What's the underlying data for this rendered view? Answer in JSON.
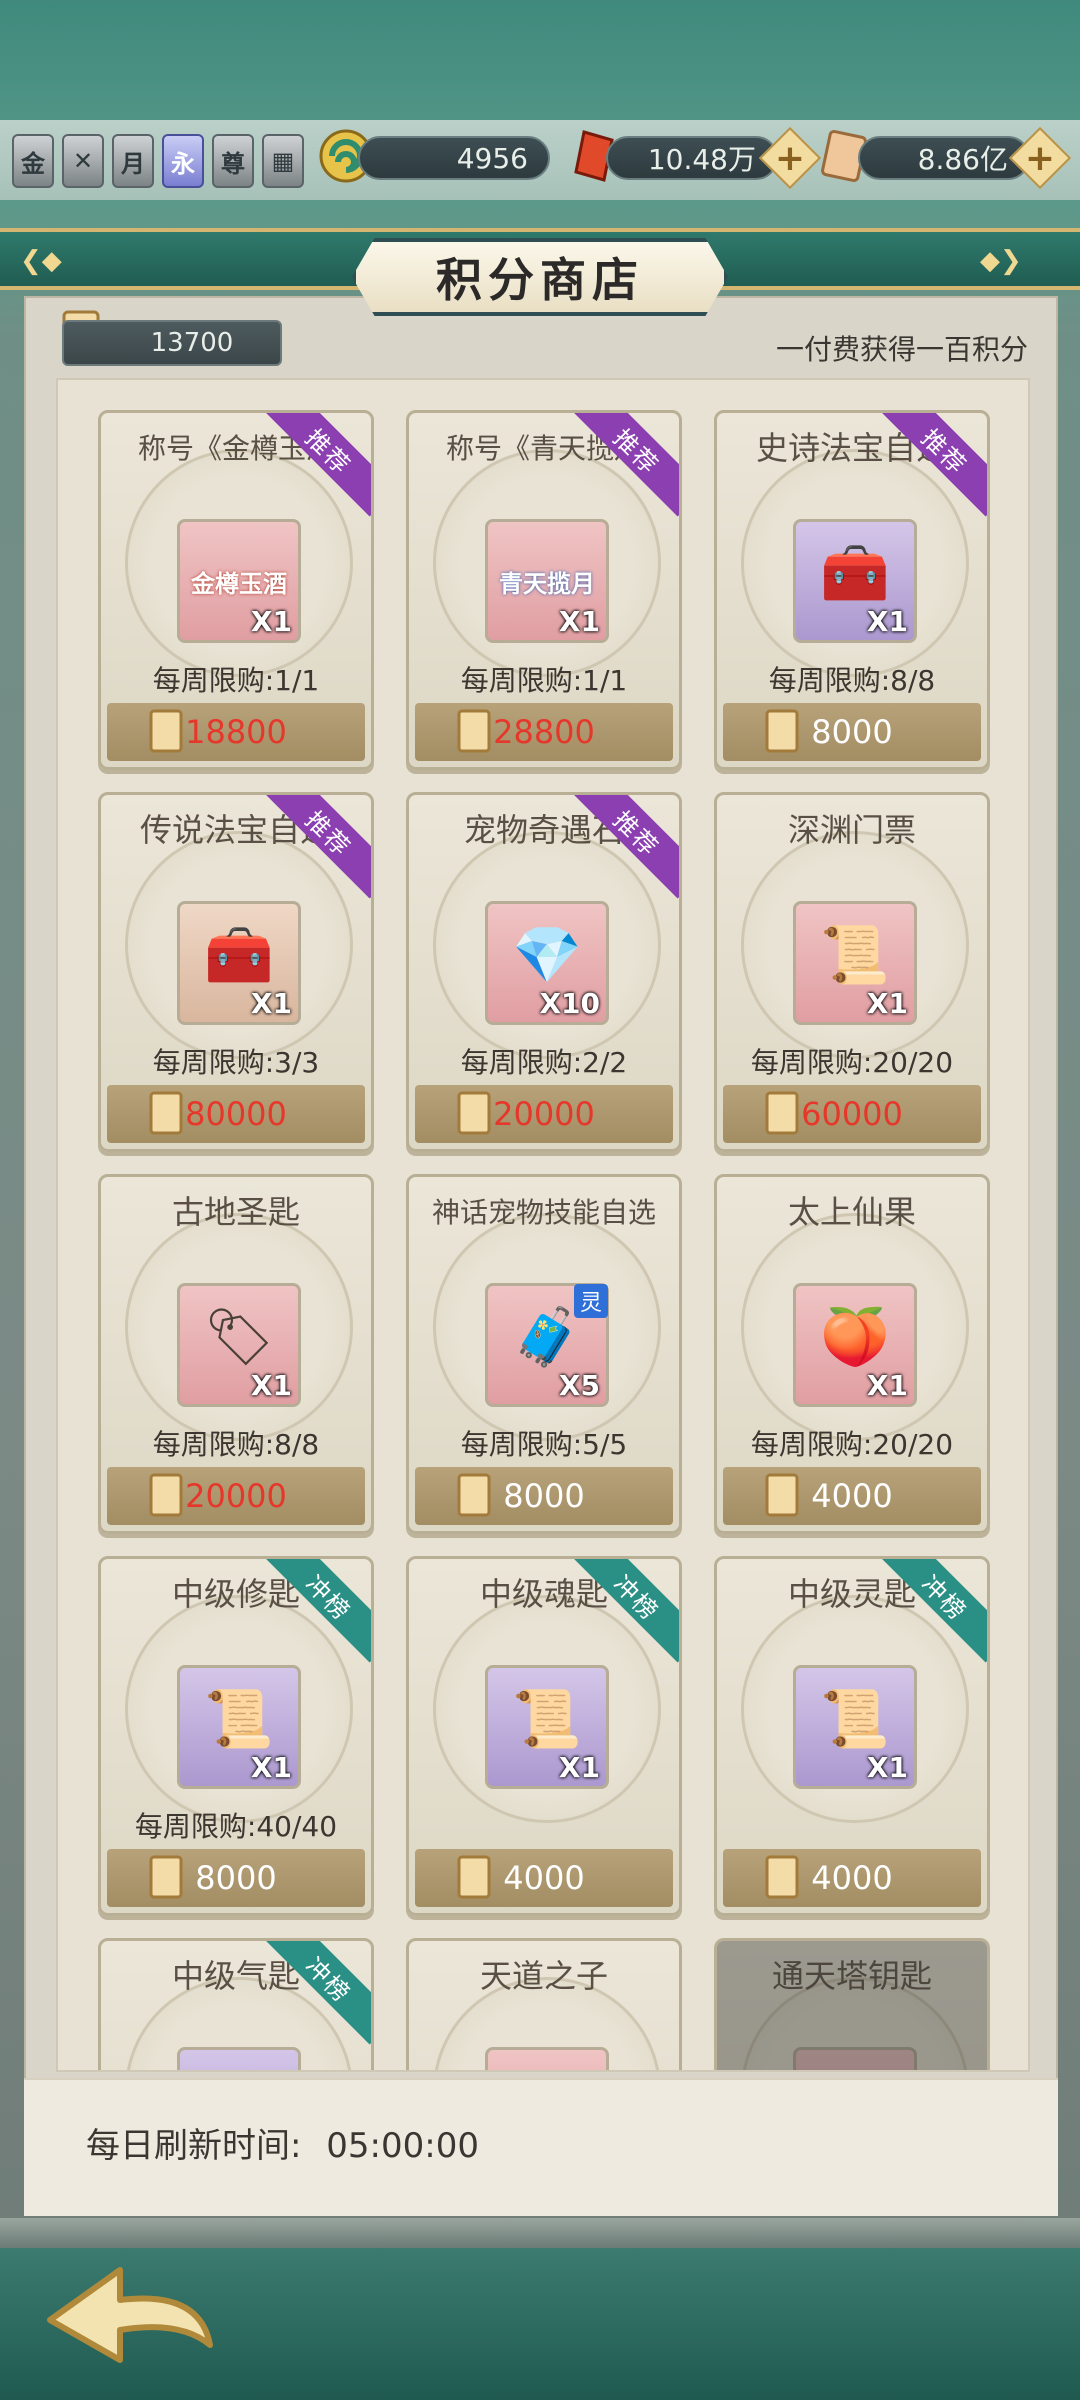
{
  "badges": [
    "金",
    "",
    "月",
    "永",
    "尊",
    ""
  ],
  "currencies": {
    "jade": "4956",
    "crystal": "10.48万",
    "scroll": "8.86亿"
  },
  "title": "积分商店",
  "points": "13700",
  "tip": "一付费获得一百积分",
  "items": [
    {
      "name": "称号《金樽玉酒",
      "qty": "X1",
      "limit": "每周限购:1/1",
      "price": "18800",
      "tag": "推荐",
      "thumb_text": "金樽玉酒"
    },
    {
      "name": "称号《青天揽月",
      "qty": "X1",
      "limit": "每周限购:1/1",
      "price": "28800",
      "tag": "推荐",
      "thumb_text": "青天揽月"
    },
    {
      "name": "史诗法宝自选",
      "qty": "X1",
      "limit": "每周限购:8/8",
      "price": "8000",
      "tag": "推荐"
    },
    {
      "name": "传说法宝自选",
      "qty": "X1",
      "limit": "每周限购:3/3",
      "price": "80000",
      "tag": "推荐"
    },
    {
      "name": "宠物奇遇石",
      "qty": "X10",
      "limit": "每周限购:2/2",
      "price": "20000",
      "tag": "推荐"
    },
    {
      "name": "深渊门票",
      "qty": "X1",
      "limit": "每周限购:20/20",
      "price": "60000"
    },
    {
      "name": "古地圣匙",
      "qty": "X1",
      "limit": "每周限购:8/8",
      "price": "20000"
    },
    {
      "name": "神话宠物技能自选",
      "qty": "X5",
      "limit": "每周限购:5/5",
      "price": "8000",
      "corner": "灵"
    },
    {
      "name": "太上仙果",
      "qty": "X1",
      "limit": "每周限购:20/20",
      "price": "4000"
    },
    {
      "name": "中级修匙",
      "qty": "X1",
      "limit": "每周限购:40/40",
      "price": "8000",
      "tag": "冲榜"
    },
    {
      "name": "中级魂匙",
      "qty": "X1",
      "price": "4000",
      "tag": "冲榜"
    },
    {
      "name": "中级灵匙",
      "qty": "X1",
      "price": "4000",
      "tag": "冲榜"
    },
    {
      "name": "中级气匙",
      "tag": "冲榜"
    },
    {
      "name": "天道之子"
    },
    {
      "name": "通天塔钥匙"
    }
  ],
  "refresh": {
    "label": "每日刷新时间:",
    "time": "05:00:00"
  },
  "colors": {
    "price_red": "#e6372b",
    "tag_recommend": "#8b3fb0",
    "tag_rank": "#2a8f84"
  },
  "icons": [
    "jade-coin-icon",
    "red-crystal-icon",
    "scroll-currency-icon",
    "plus-icon",
    "back-arrow-icon"
  ]
}
